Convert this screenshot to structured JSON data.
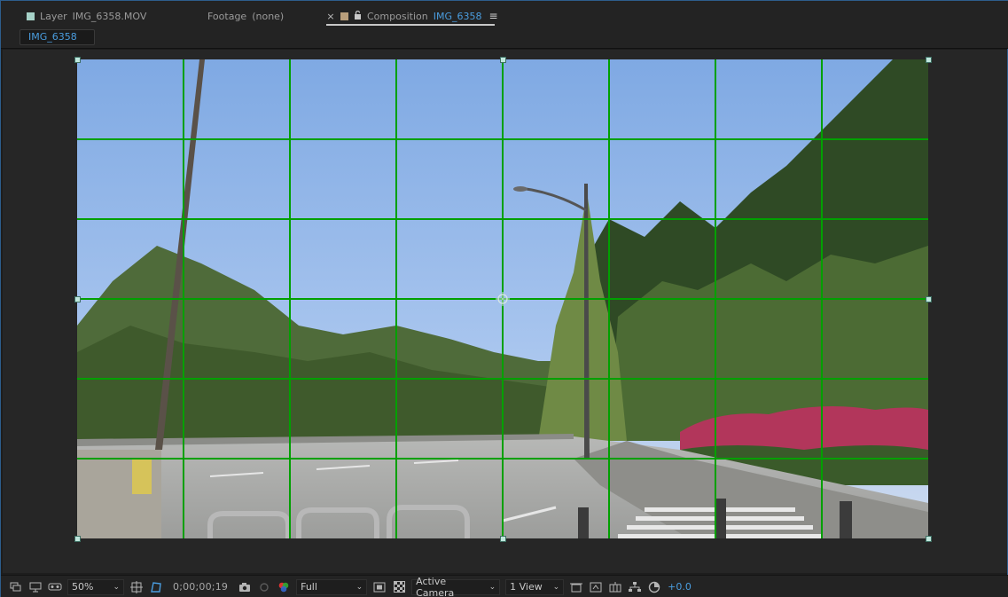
{
  "tabs": {
    "layer": {
      "prefix": "Layer",
      "name": "IMG_6358.MOV"
    },
    "footage": {
      "prefix": "Footage",
      "name": "(none)"
    },
    "composition": {
      "prefix": "Composition",
      "name": "IMG_6358",
      "active": true
    }
  },
  "comp_chip": "IMG_6358",
  "icons": {
    "tab_close": "close-icon",
    "tab_lock": "lock-icon",
    "tab_menu": "hamburger-menu-icon"
  },
  "colors": {
    "accent": "#4a9ddf",
    "grid": "#00a000",
    "handle": "#bfe7dd",
    "layer_swatch": "#a6d2c8",
    "comp_swatch": "#b89e7b"
  },
  "toolbar": {
    "zoom": "50%",
    "timecode": "0;00;00;19",
    "resolution": "Full",
    "camera": "Active Camera",
    "views": "1 View",
    "exposure": "+0.0"
  },
  "glyphs": {
    "close": "×",
    "lock": "🔓",
    "menu": "≡",
    "chevron": "⌄"
  },
  "viewer": {
    "grid_columns": 8,
    "grid_rows": 6,
    "show_grid": true
  }
}
